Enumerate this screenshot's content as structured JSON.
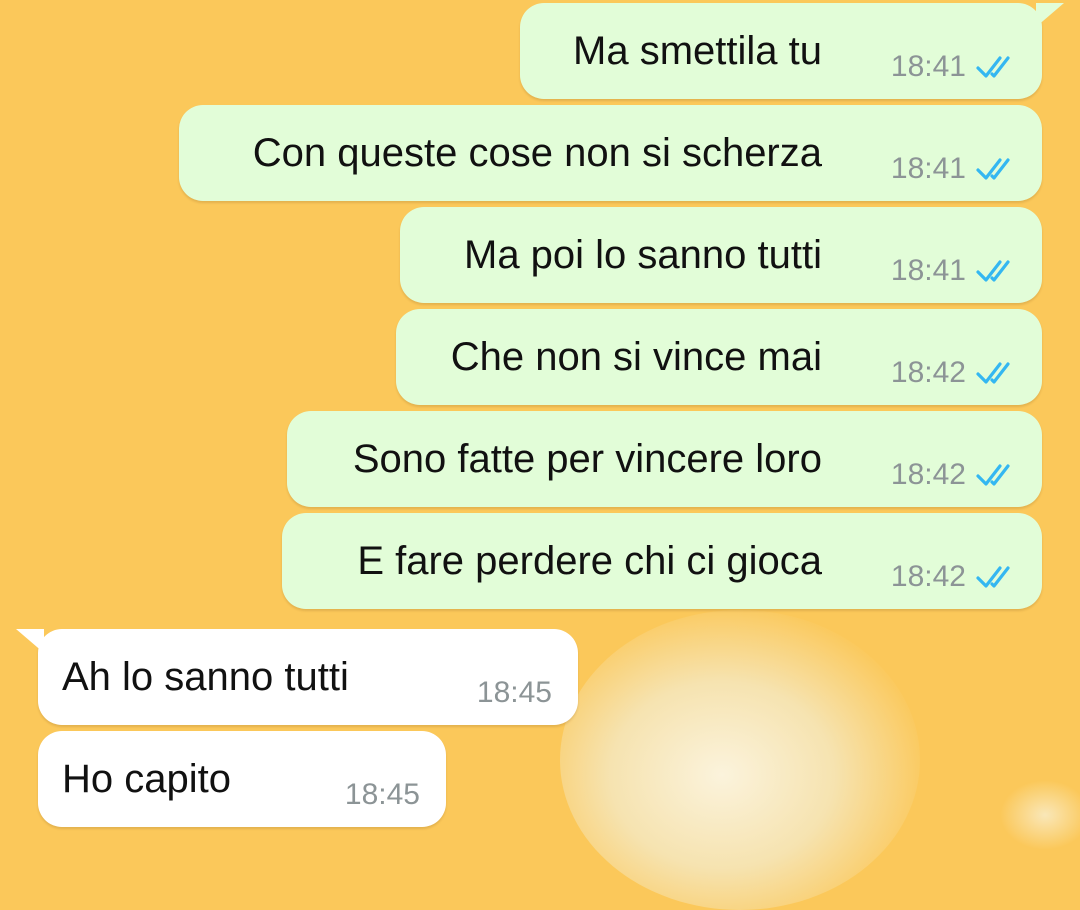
{
  "colors": {
    "wallpaper": "#fbc85a",
    "outgoing_bubble": "#e2fdd8",
    "incoming_bubble": "#ffffff",
    "read_ticks": "#34b7f1",
    "timestamp": "#8c9496"
  },
  "messages": [
    {
      "direction": "outgoing",
      "text": "Ma smettila tu",
      "time": "18:41",
      "status": "read",
      "status_icon": "double-check-icon"
    },
    {
      "direction": "outgoing",
      "text": "Con queste cose non si scherza",
      "time": "18:41",
      "status": "read",
      "status_icon": "double-check-icon"
    },
    {
      "direction": "outgoing",
      "text": "Ma poi lo sanno tutti",
      "time": "18:41",
      "status": "read",
      "status_icon": "double-check-icon"
    },
    {
      "direction": "outgoing",
      "text": "Che non si vince mai",
      "time": "18:42",
      "status": "read",
      "status_icon": "double-check-icon"
    },
    {
      "direction": "outgoing",
      "text": "Sono fatte per vincere loro",
      "time": "18:42",
      "status": "read",
      "status_icon": "double-check-icon"
    },
    {
      "direction": "outgoing",
      "text": "E fare perdere chi ci gioca",
      "time": "18:42",
      "status": "read",
      "status_icon": "double-check-icon"
    },
    {
      "direction": "incoming",
      "text": "Ah lo sanno tutti",
      "time": "18:45"
    },
    {
      "direction": "incoming",
      "text": "Ho capito",
      "time": "18:45"
    }
  ]
}
